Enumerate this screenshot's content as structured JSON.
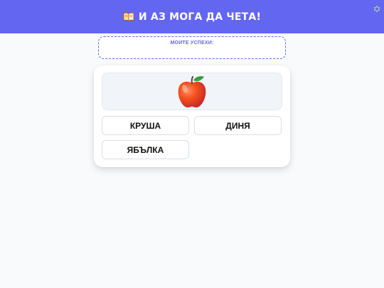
{
  "header": {
    "title": "И АЗ МОГА ДА ЧЕТА!",
    "icon": "book-icon",
    "settings_icon": "gear-icon",
    "background_color": "#6366f1"
  },
  "successes": {
    "label": "МОИТЕ УСПЕХИ:"
  },
  "quiz": {
    "picture": "apple-icon",
    "answers": [
      {
        "label": "КРУША"
      },
      {
        "label": "ДИНЯ"
      },
      {
        "label": "ЯБЪЛКА"
      }
    ]
  }
}
